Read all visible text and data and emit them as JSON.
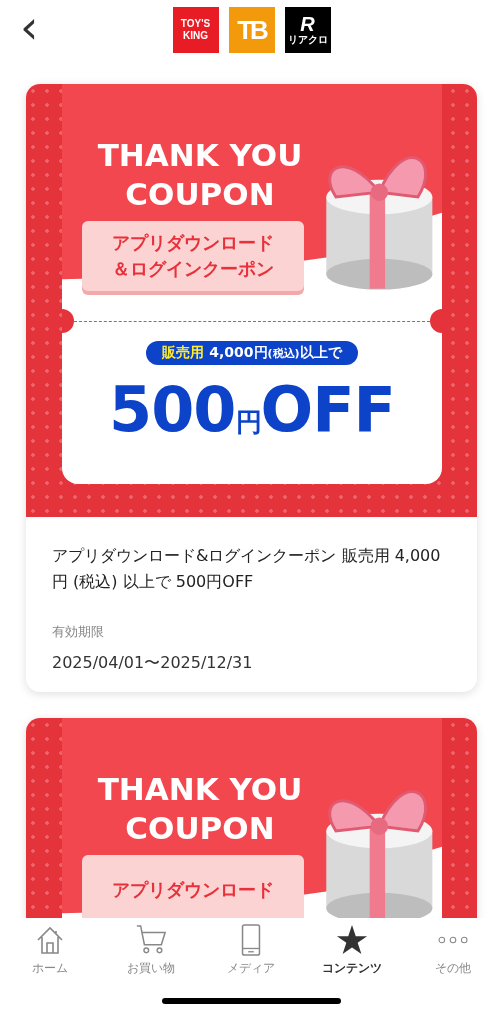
{
  "header": {
    "back": "‹",
    "logos": [
      {
        "kind": "toys-king",
        "lines": [
          "TOY'S",
          "KING"
        ]
      },
      {
        "kind": "tb",
        "lines": [
          "TB"
        ]
      },
      {
        "kind": "riaclo",
        "lines": [
          "R",
          "リアクロ"
        ]
      }
    ]
  },
  "coupons": [
    {
      "headline": [
        "THANK YOU",
        "COUPON"
      ],
      "label": [
        "アプリダウンロード",
        "＆ログインクーポン"
      ],
      "condition": {
        "highlight": "販売用",
        "amount": "4,000円",
        "small": "(税込)",
        "tail": "以上で"
      },
      "discount": {
        "amount": "500",
        "unit": "円",
        "off": "OFF"
      },
      "title": "アプリダウンロード&ログインクーポン 販売用 4,000円 (税込) 以上で 500円OFF",
      "expiry_label": "有効期限",
      "expiry": "2025/04/01〜2025/12/31"
    },
    {
      "headline": [
        "THANK YOU",
        "COUPON"
      ],
      "label": [
        "アプリダウンロード"
      ]
    }
  ],
  "tabs": [
    {
      "kind": "home",
      "label": "ホーム",
      "selected": false
    },
    {
      "kind": "cart",
      "label": "お買い物",
      "selected": false
    },
    {
      "kind": "phone",
      "label": "メディア",
      "selected": false
    },
    {
      "kind": "star",
      "label": "コンテンツ",
      "selected": true
    },
    {
      "kind": "more",
      "label": "その他",
      "selected": false
    }
  ]
}
